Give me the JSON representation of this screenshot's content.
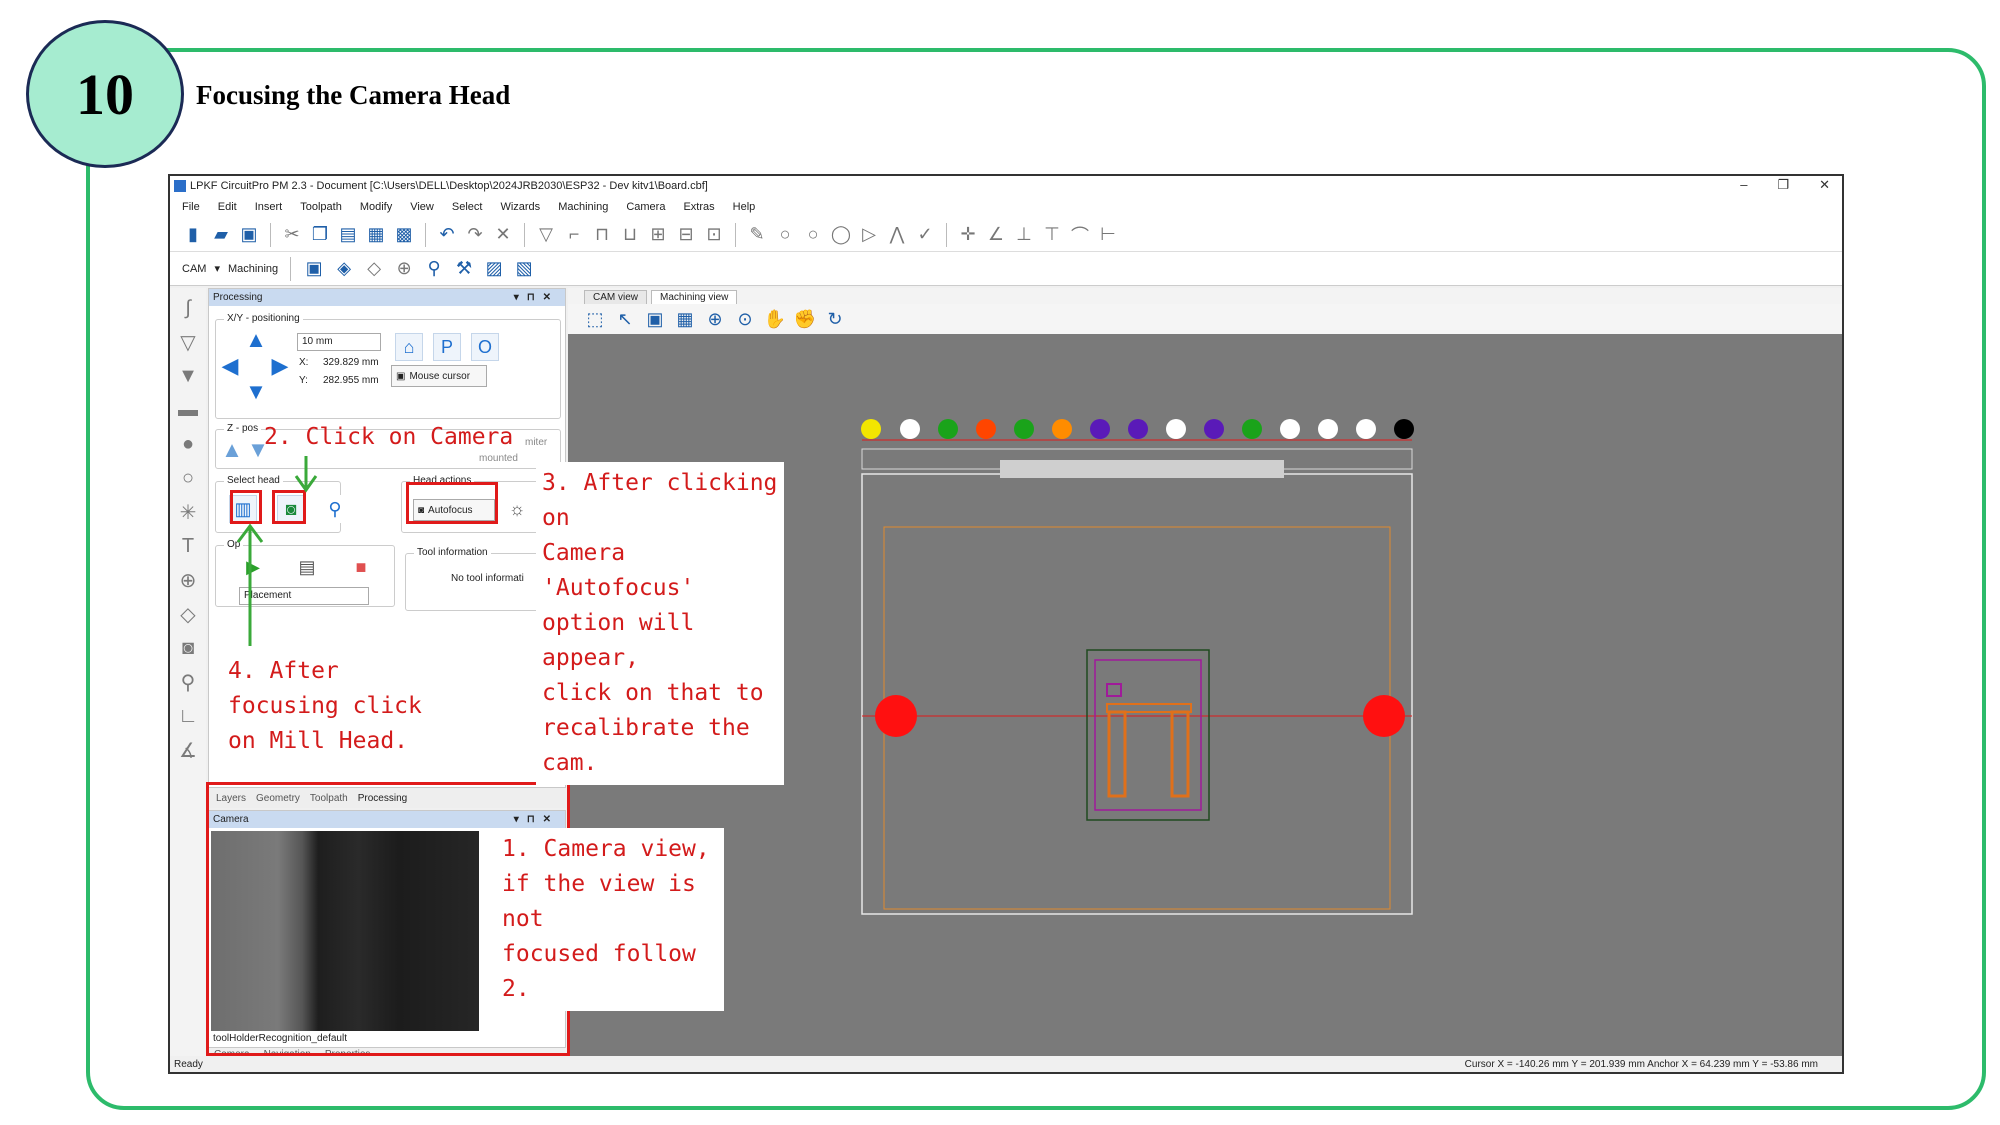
{
  "step": {
    "number": "10",
    "title": "Focusing the Camera Head"
  },
  "window": {
    "title": "LPKF CircuitPro PM 2.3 - Document [C:\\Users\\DELL\\Desktop\\2024JRB2030\\ESP32 - Dev kitv1\\Board.cbf]",
    "controls": [
      "–",
      "❐",
      "✕"
    ]
  },
  "menu": [
    "File",
    "Edit",
    "Insert",
    "Toolpath",
    "Modify",
    "View",
    "Select",
    "Wizards",
    "Machining",
    "Camera",
    "Extras",
    "Help"
  ],
  "toolbar2": {
    "mode": "CAM",
    "machining": "Machining"
  },
  "processing": {
    "title": "Processing",
    "xy_group": "X/Y - positioning",
    "step_value": "10 mm",
    "x_label": "X:",
    "x_value": "329.829 mm",
    "y_label": "Y:",
    "y_value": "282.955 mm",
    "mouse_cursor": "Mouse cursor",
    "z_group": "Z - pos",
    "limiter": "miter",
    "mounted": "mounted",
    "select_head": "Select head",
    "head_actions": "Head actions",
    "autofocus": "Autofocus",
    "options": "Op",
    "placement": "Placement",
    "tool_info_title": "Tool information",
    "tool_info_text": "No tool informati"
  },
  "bottom_tabs": [
    "Layers",
    "Geometry",
    "Toolpath",
    "Processing"
  ],
  "camera": {
    "title": "Camera",
    "footer": "toolHolderRecognition_default",
    "tabs": [
      "Camera",
      "Navigation",
      "Properties"
    ]
  },
  "views": {
    "cam": "CAM view",
    "machining": "Machining view"
  },
  "status": {
    "left": "Ready",
    "cursor": "Cursor X =  -140.26 mm   Y =  201.939 mm       Anchor X =  64.239 mm   Y =  -53.86 mm"
  },
  "annotations": {
    "n1": "1. Camera view,\nif the view is not\nfocused follow 2.",
    "n2": "2. Click on Camera",
    "n3": "3. After clicking on\nCamera 'Autofocus'\noption will appear,\nclick on that to\nrecalibrate the\ncam.",
    "n4": "4. After\nfocusing click\non Mill Head."
  },
  "colors": {
    "frame": "#2dbb6b",
    "circle": "#a6ecd0",
    "annotation": "#d31b1b",
    "highlight": "#e01a1a",
    "arrow": "#3aa93a",
    "canvas": "#7a7a7a",
    "dots": [
      "#f2e600",
      "#ffffff",
      "#1aa31a",
      "#ff4500",
      "#1aa31a",
      "#ff8c00",
      "#5a1ab8",
      "#5a1ab8",
      "#ffffff",
      "#5a1ab8",
      "#1aa31a",
      "#ffffff",
      "#ffffff",
      "#ffffff",
      "#000000"
    ]
  }
}
